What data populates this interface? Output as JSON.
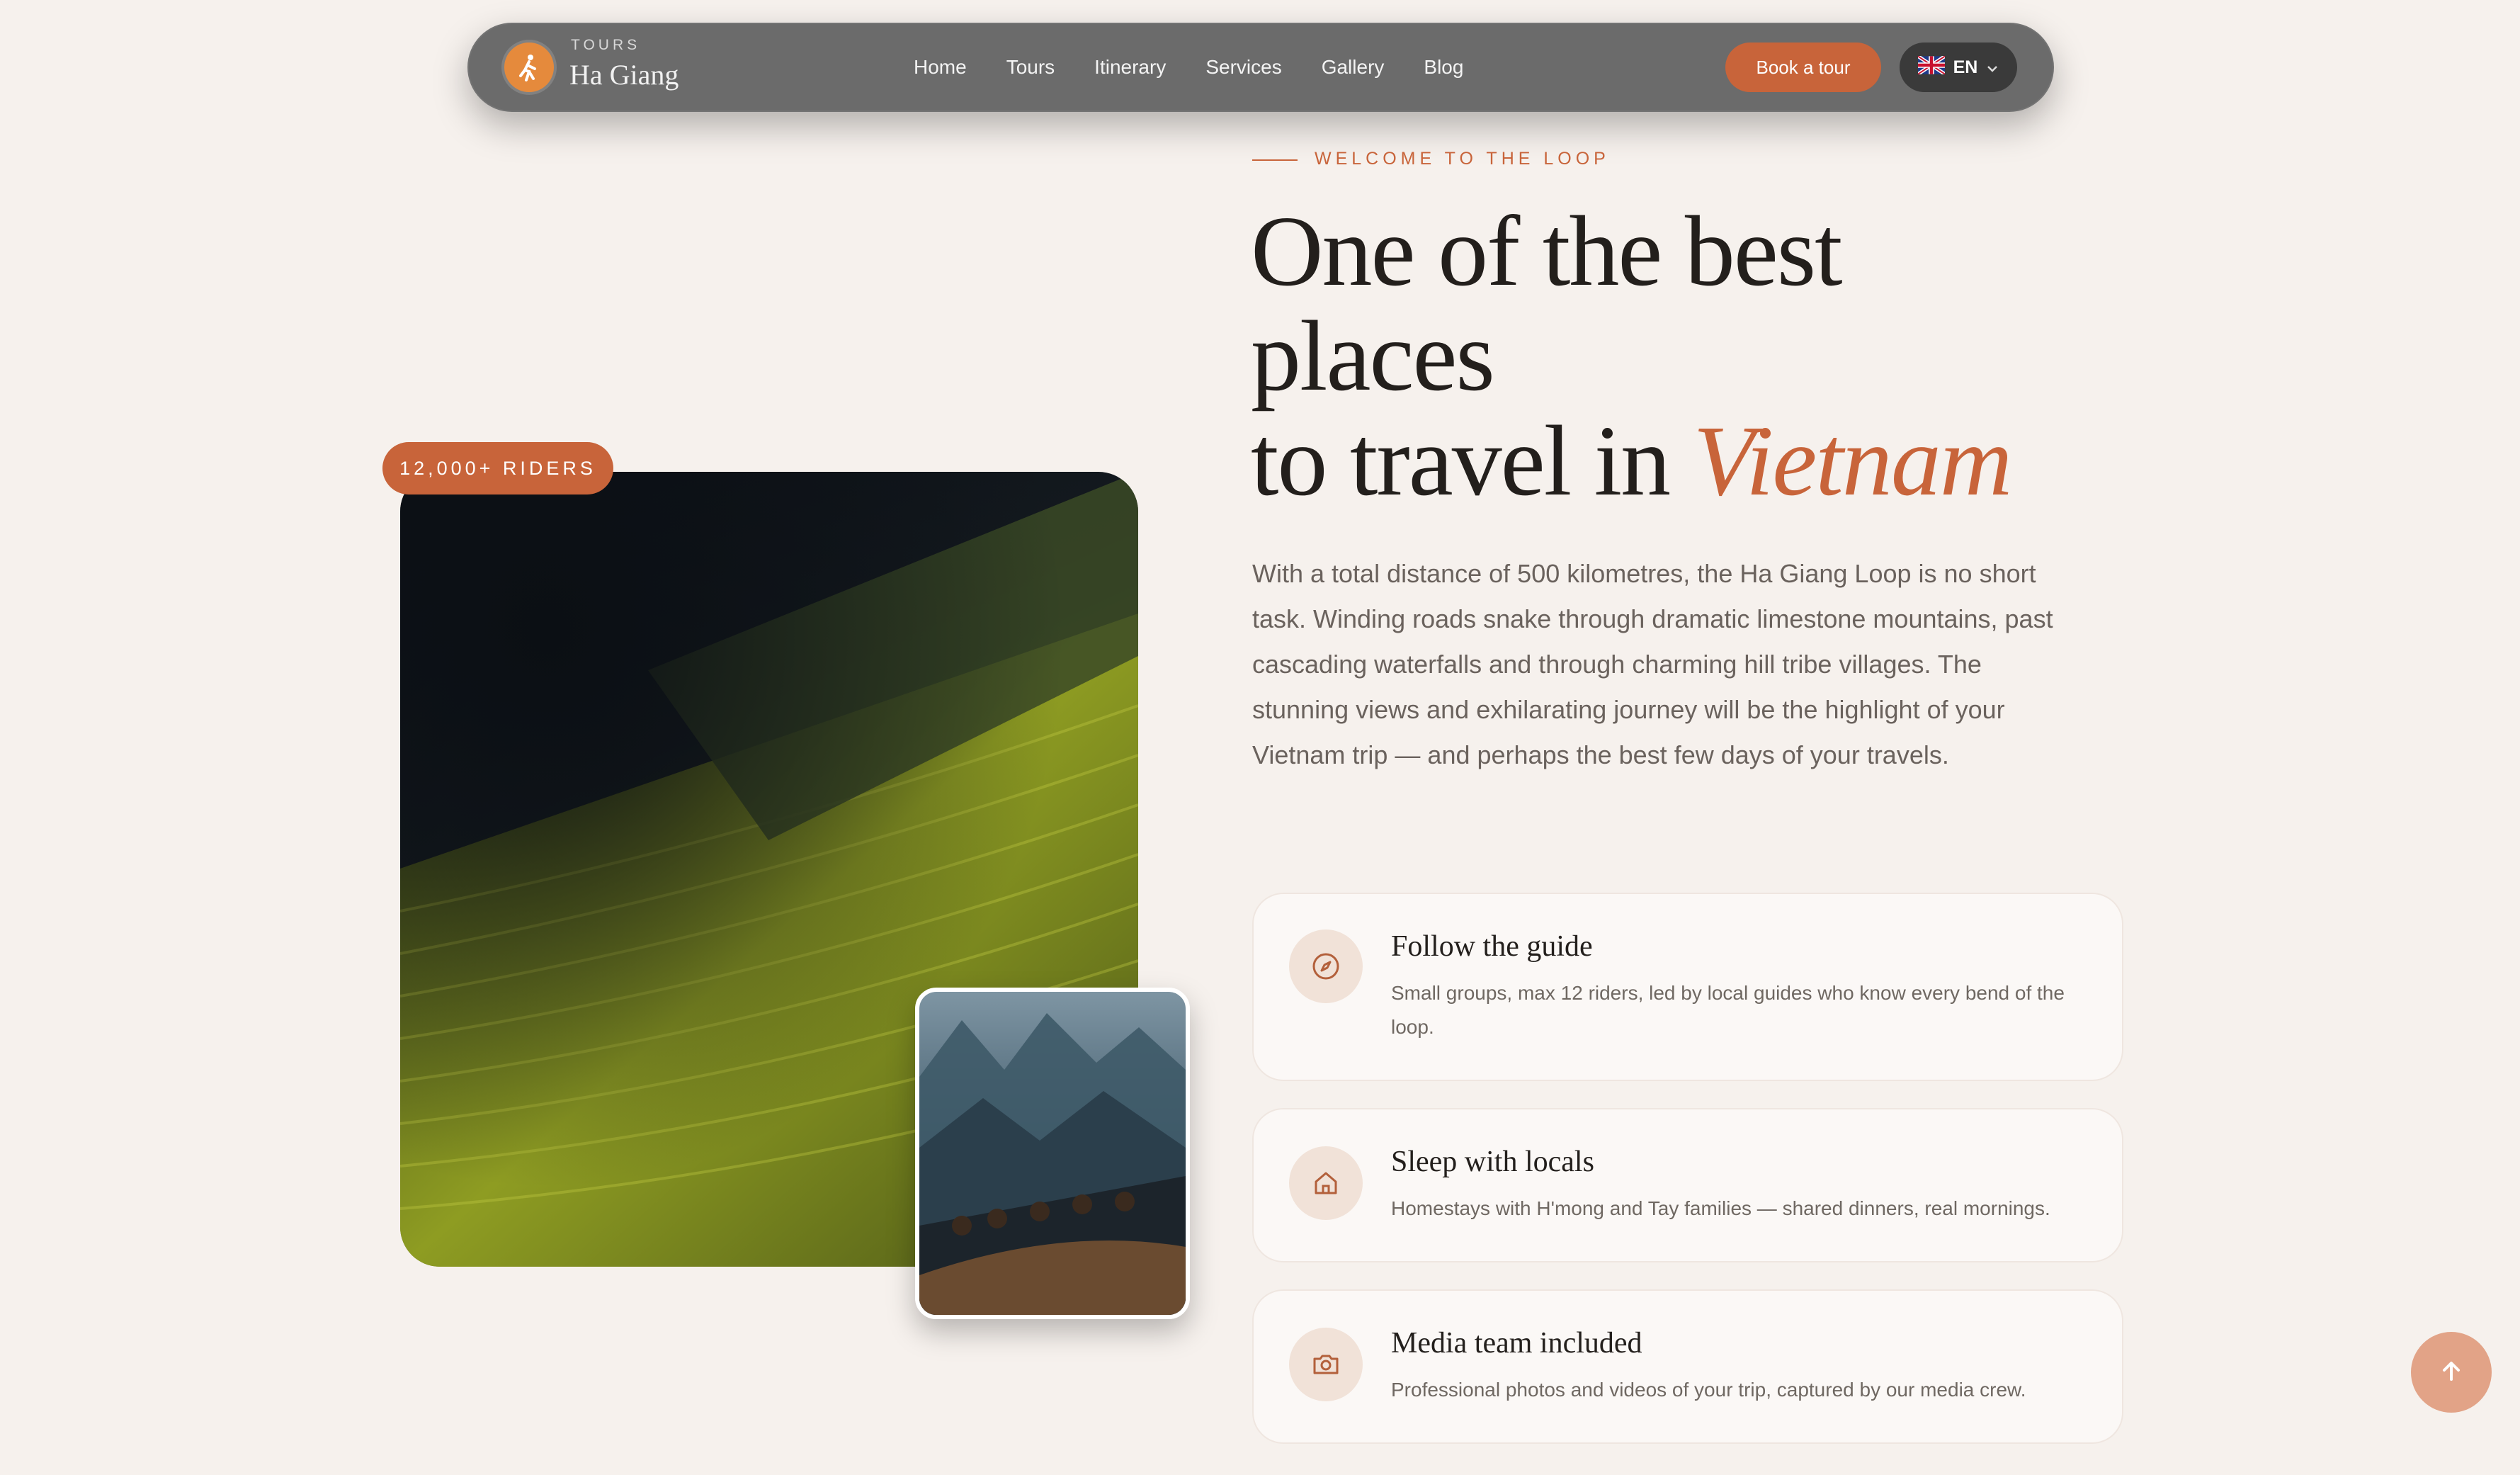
{
  "nav": {
    "brand_small": "TOURS",
    "brand_name": "Ha Giang",
    "links": [
      "Home",
      "Tours",
      "Itinerary",
      "Services",
      "Gallery",
      "Blog"
    ],
    "book_label": "Book a tour",
    "lang_label": "EN",
    "lang_icon": "uk-flag-icon"
  },
  "hero": {
    "riders_badge": "12,000+ RIDERS",
    "eyebrow": "WELCOME TO THE LOOP",
    "headline_line1": "One of the best",
    "headline_line2": "places",
    "headline_line3": "to travel in ",
    "headline_accent": "Vietnam",
    "lead": "With a total distance of 500 kilometres, the Ha Giang Loop is no short task. Winding roads snake through dramatic limestone mountains, past cascading waterfalls and through charming hill tribe villages. The stunning views and exhilarating journey will be the highlight of your Vietnam trip — and perhaps the best few days of your travels."
  },
  "features": [
    {
      "icon": "compass-icon",
      "title": "Follow the guide",
      "desc": "Small groups, max 12 riders, led by local guides who know every bend of the loop."
    },
    {
      "icon": "home-icon",
      "title": "Sleep with locals",
      "desc": "Homestays with H'mong and Tay families — shared dinners, real mornings."
    },
    {
      "icon": "camera-icon",
      "title": "Media team included",
      "desc": "Professional photos and videos of your trip, captured by our media crew."
    }
  ],
  "colors": {
    "accent": "#c8643a",
    "background": "#f6f1ed",
    "nav_bg": "#6b6b6b"
  }
}
